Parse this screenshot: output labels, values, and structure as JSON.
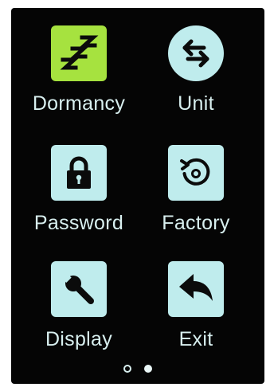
{
  "menu": {
    "items": [
      {
        "label": "Dormancy",
        "icon": "sleep-zzz-icon",
        "active": true
      },
      {
        "label": "Unit",
        "icon": "swap-arrows-icon",
        "active": false
      },
      {
        "label": "Password",
        "icon": "lock-icon",
        "active": false
      },
      {
        "label": "Factory",
        "icon": "reset-rotate-icon",
        "active": false
      },
      {
        "label": "Display",
        "icon": "wrench-icon",
        "active": false
      },
      {
        "label": "Exit",
        "icon": "back-arrow-icon",
        "active": false
      }
    ]
  },
  "pagination": {
    "current_page": 2,
    "total_pages": 2
  },
  "colors": {
    "background": "#050505",
    "tile": "#bfeced",
    "tile_active": "#a6e23f",
    "label": "#d8efef",
    "icon": "#0b0b0b"
  }
}
